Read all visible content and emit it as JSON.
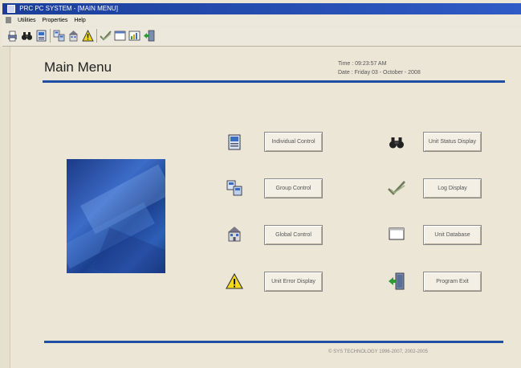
{
  "window": {
    "title": "PRC PC SYSTEM - [MAIN MENU]"
  },
  "menubar": {
    "items": [
      "Utilities",
      "Properties",
      "Help"
    ]
  },
  "toolbar": {
    "icons": [
      "print-icon",
      "binoculars-icon",
      "panel-icon",
      "group-icon",
      "global-icon",
      "warning-icon",
      "checkmark-icon",
      "window-icon",
      "chart-icon",
      "exit-door-icon"
    ]
  },
  "page": {
    "title": "Main Menu",
    "time": "Time : 09:23:57  AM",
    "date": "Date : Friday  03 - October - 2008",
    "footer": "© SYS TECHNOLOGY 1996-2007, 2002-2005"
  },
  "menu": {
    "individual": "Individual Control",
    "group": "Group Control",
    "global": "Global Control",
    "unit_error": "Unit Error Display",
    "unit_status": "Unit Status Display",
    "log": "Log Display",
    "unit_database": "Unit Database",
    "program_exit": "Program Exit"
  },
  "colors": {
    "accent": "#1f4ea3",
    "background": "#ece6d6",
    "titlebar": "#1b3e9a"
  }
}
